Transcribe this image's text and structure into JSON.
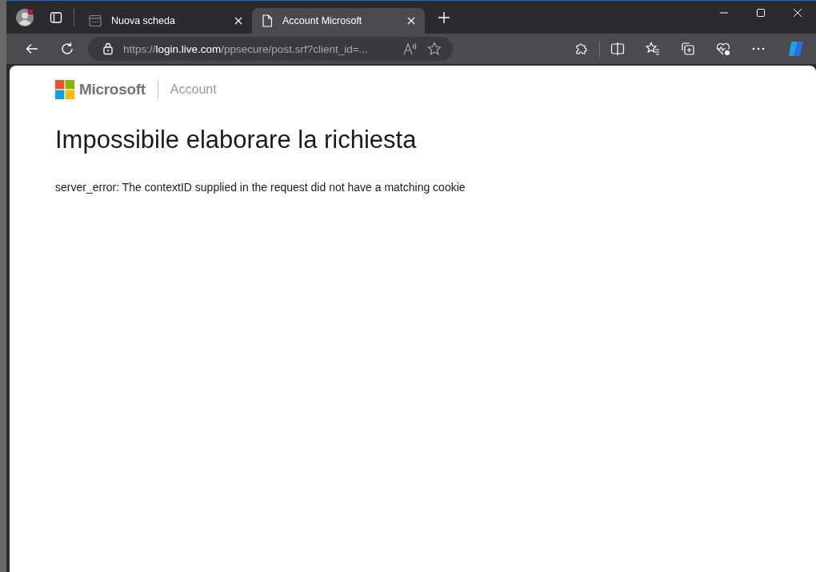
{
  "tabs": [
    {
      "kind": "newtab",
      "label": "Nuova scheda",
      "selected": false
    },
    {
      "kind": "page",
      "label": "Account Microsoft",
      "selected": true
    }
  ],
  "address_bar": {
    "url_parts": [
      {
        "text": "https://",
        "kind": "scheme"
      },
      {
        "text": "login.live.com",
        "kind": "host"
      },
      {
        "text": "/ppsecure/post.srf?client_id=...",
        "kind": "path"
      }
    ]
  },
  "page": {
    "brand": "Microsoft",
    "section": "Account",
    "heading": "Impossibile elaborare la richiesta",
    "message": "server_error: The contextID supplied in the request did not have a matching cookie"
  }
}
